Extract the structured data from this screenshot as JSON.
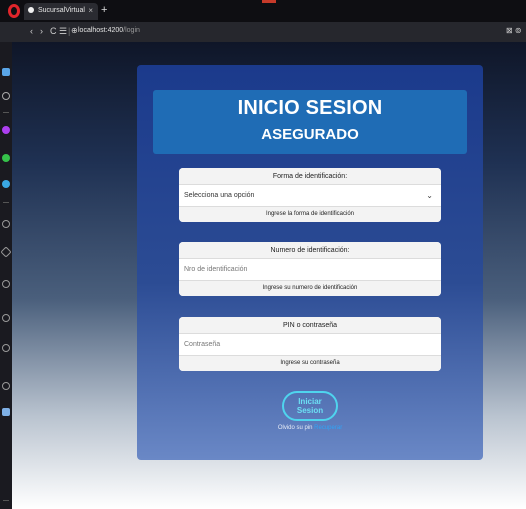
{
  "browser": {
    "tab": {
      "title": "SucursalVirtual",
      "close_glyph": "×"
    },
    "new_tab_glyph": "+",
    "nav": {
      "back": "‹",
      "forward": "›",
      "reload": "C",
      "speed_dial": "☰",
      "site_info": "⊕",
      "sep": "|"
    },
    "url": {
      "host": "localhost:4200",
      "path": "/login"
    },
    "right_icons": "⊠ ⊚"
  },
  "colors": {
    "accent": "#1f6cb5",
    "button_border": "#4fd4ee"
  },
  "login": {
    "title": "INICIO SESION",
    "subtitle": "ASEGURADO",
    "id_type": {
      "label": "Forma de identificación:",
      "selected": "Selecciona una opción",
      "chevron": "⌄",
      "help": "Ingrese la forma de identificación"
    },
    "id_number": {
      "label": "Numero de identificación:",
      "placeholder": "Nro de identificación",
      "help": "Ingrese su numero de identificación"
    },
    "pin": {
      "label": "PIN o contraseña",
      "placeholder": "Contraseña",
      "help": "Ingrese su contraseña"
    },
    "submit": "Iniciar Sesion",
    "forgot_text": "Olvido su pin",
    "forgot_link": "Recuperar"
  }
}
